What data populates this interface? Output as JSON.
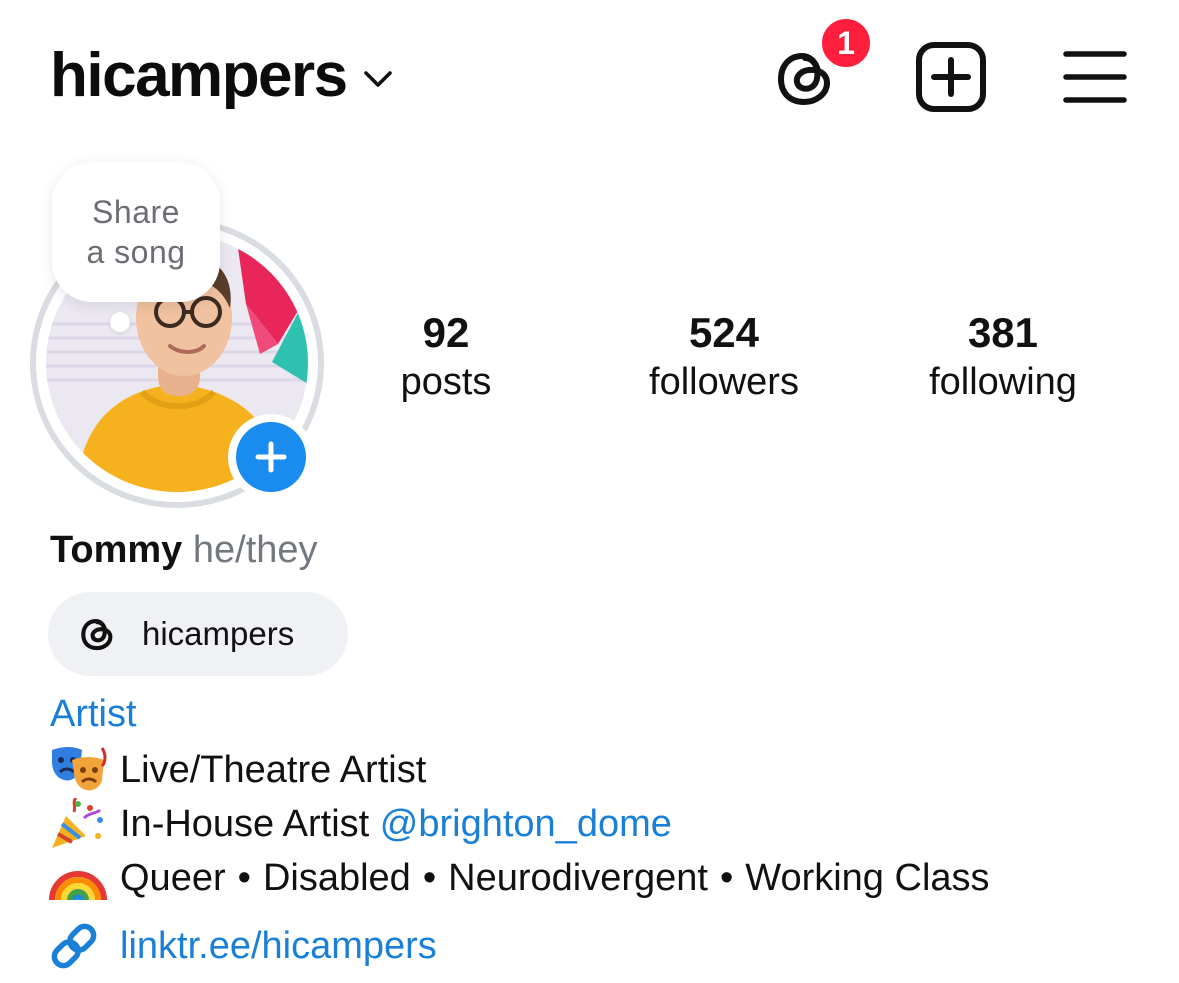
{
  "header": {
    "username": "hicampers",
    "notification_count": "1"
  },
  "avatar": {
    "note_line1": "Share",
    "note_line2": "a song"
  },
  "stats": [
    {
      "value": "92",
      "label": "posts"
    },
    {
      "value": "524",
      "label": "followers"
    },
    {
      "value": "381",
      "label": "following"
    }
  ],
  "profile": {
    "name": "Tommy",
    "pronouns": "he/they",
    "threads_handle": "hicampers",
    "category": "Artist"
  },
  "bio": {
    "line1": "Live/Theatre Artist",
    "line2_prefix": "In-House Artist",
    "line2_mention": "@brighton_dome",
    "line3_items": [
      "Queer",
      "Disabled",
      "Neurodivergent",
      "Working Class"
    ],
    "separator": "•"
  },
  "link": {
    "text": "linktr.ee/hicampers"
  },
  "colors": {
    "link_blue": "#1a7fd6",
    "badge_red": "#ff1f3d",
    "add_story_blue": "#1a8cf0",
    "secondary_text": "#737880"
  },
  "icons": {
    "threads": "threads-icon",
    "create": "plus-square-icon",
    "menu": "hamburger-menu-icon",
    "chevron": "chevron-down-icon",
    "add_story": "plus-icon",
    "link": "link-icon",
    "bio1": "performing-arts-emoji",
    "bio2": "party-popper-emoji",
    "bio3": "rainbow-emoji"
  }
}
